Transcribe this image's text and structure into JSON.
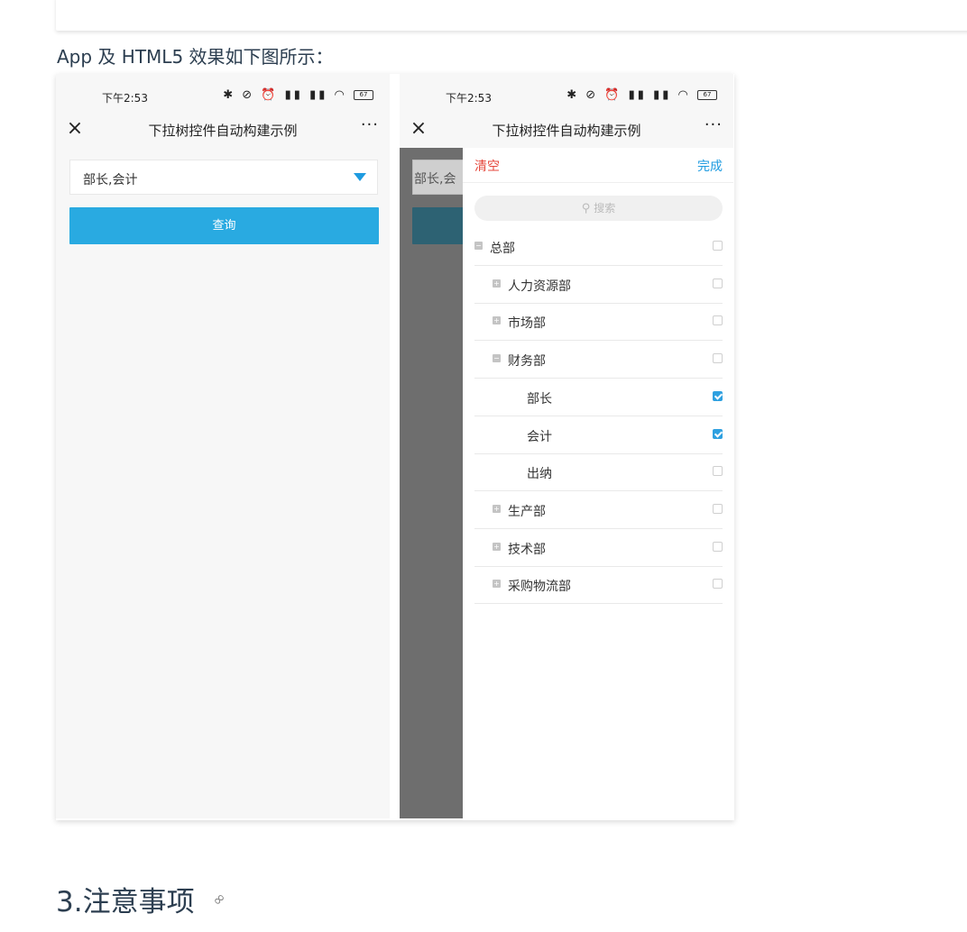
{
  "intro_text": "App 及 HTML5 效果如下图所示：",
  "status": {
    "time": "下午2:53",
    "icons": "✱ ⊘ ⏰ ▮▮ ▮▮ ◠",
    "battery": "67"
  },
  "nav": {
    "close": "×",
    "title": "下拉树控件自动构建示例",
    "more": "···"
  },
  "form": {
    "select_value": "部长,会计",
    "query_label": "查询"
  },
  "overlay": {
    "select_partial": "部长,会"
  },
  "panel": {
    "clear_label": "清空",
    "done_label": "完成",
    "search_placeholder": "搜索",
    "items": [
      {
        "label": "总部",
        "level": 0,
        "expander": "minus",
        "checked": false
      },
      {
        "label": "人力资源部",
        "level": 1,
        "expander": "plus",
        "checked": false
      },
      {
        "label": "市场部",
        "level": 1,
        "expander": "plus",
        "checked": false
      },
      {
        "label": "财务部",
        "level": 1,
        "expander": "minus",
        "checked": false
      },
      {
        "label": "部长",
        "level": 2,
        "expander": "none",
        "checked": true
      },
      {
        "label": "会计",
        "level": 2,
        "expander": "none",
        "checked": true
      },
      {
        "label": "出纳",
        "level": 2,
        "expander": "none",
        "checked": false
      },
      {
        "label": "生产部",
        "level": 1,
        "expander": "plus",
        "checked": false
      },
      {
        "label": "技术部",
        "level": 1,
        "expander": "plus",
        "checked": false
      },
      {
        "label": "采购物流部",
        "level": 1,
        "expander": "plus",
        "checked": false
      }
    ]
  },
  "section_heading": "3.注意事项",
  "colors": {
    "accent": "#29aae1",
    "clear": "#e5473c",
    "done": "#1e9be0",
    "heading": "#2c3e50"
  }
}
